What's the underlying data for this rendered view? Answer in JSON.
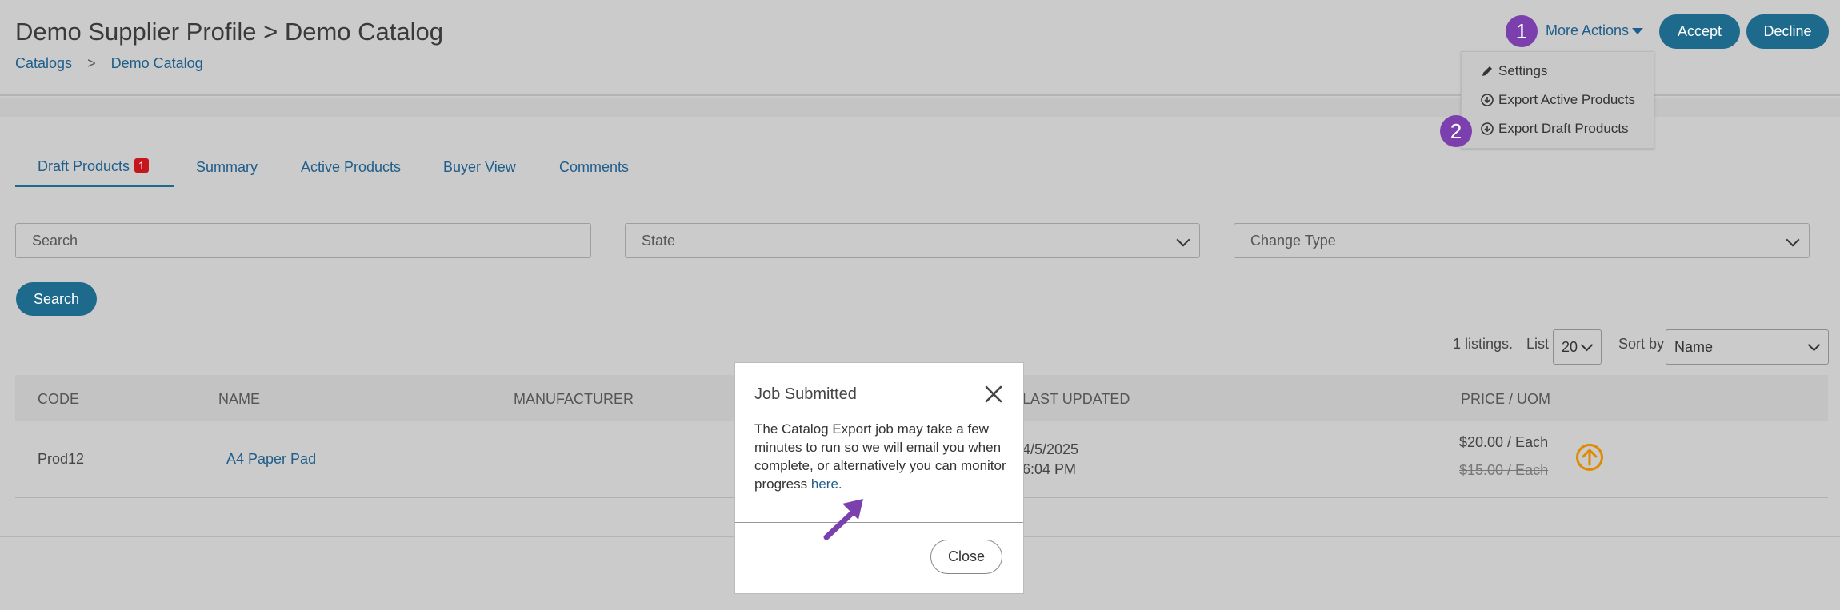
{
  "header": {
    "title": "Demo Supplier Profile > Demo Catalog",
    "breadcrumb": [
      "Catalogs",
      "Demo Catalog"
    ],
    "breadcrumb_sep": ">",
    "more_actions": "More Actions",
    "accept": "Accept",
    "decline": "Decline"
  },
  "annotations": [
    "1",
    "2"
  ],
  "more_actions_menu": [
    {
      "label": "Settings",
      "icon": "pencil-icon"
    },
    {
      "label": "Export Active Products",
      "icon": "download-circle-icon"
    },
    {
      "label": "Export Draft Products",
      "icon": "download-circle-icon"
    }
  ],
  "tabs": [
    {
      "label": "Draft Products",
      "count": "1",
      "active": true
    },
    {
      "label": "Summary"
    },
    {
      "label": "Active Products"
    },
    {
      "label": "Buyer View"
    },
    {
      "label": "Comments"
    }
  ],
  "filters": {
    "search_placeholder": "Search",
    "state_placeholder": "State",
    "change_type_placeholder": "Change Type",
    "search_button": "Search"
  },
  "listing": {
    "count": "1",
    "count_suffix": "listings.",
    "list_label": "List",
    "list_value": "20",
    "sort_label": "Sort by",
    "sort_value": "Name"
  },
  "table": {
    "columns": [
      "CODE",
      "NAME",
      "MANUFACTURER",
      "LAST UPDATED",
      "PRICE / UOM"
    ],
    "rows": [
      {
        "code": "Prod12",
        "name": "A4 Paper Pad",
        "manufacturer": "",
        "updated_date": "4/5/2025",
        "updated_time": "6:04 PM",
        "price": "$20.00 / Each",
        "old_price": "$15.00 / Each"
      }
    ]
  },
  "modal": {
    "title": "Job Submitted",
    "body_text": "The Catalog Export job may take a few minutes to run so we will email you when complete, or alternatively you can monitor progress ",
    "link_text": "here",
    "body_end": ".",
    "close_button": "Close"
  },
  "colors": {
    "accent": "#1d6a8c",
    "annotation": "#7b3fae",
    "badge": "#c4161c",
    "warning_icon": "#e08a00"
  }
}
